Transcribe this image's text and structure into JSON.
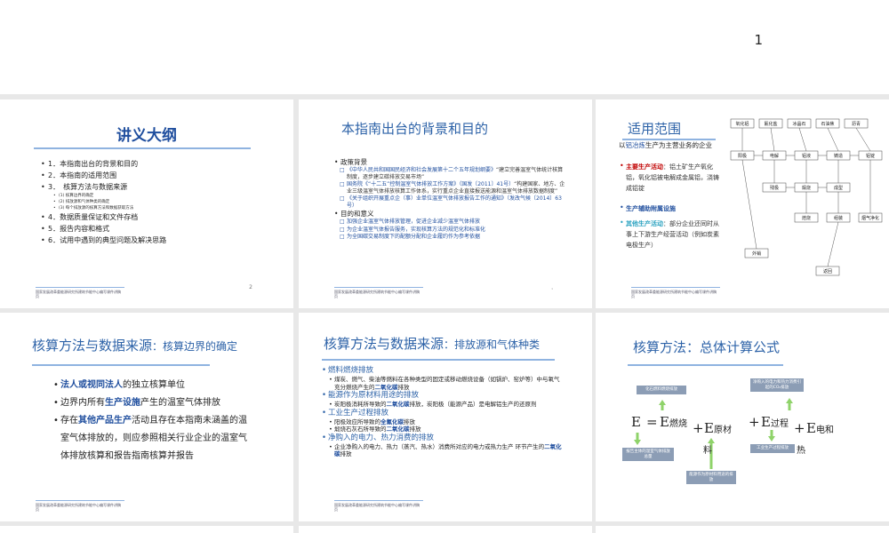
{
  "page_number": "1",
  "footer_text": "国家发展改革委能源研究所建筑节能中心编写课件讲稿",
  "footer_text_2": "页",
  "slide1": {
    "title": "讲义大纲",
    "items": [
      {
        "text": "1．本指南出台的背景和目的",
        "level": 1
      },
      {
        "text": "2．本指南的适用范围",
        "level": 1
      },
      {
        "text": "3．　核算方法与数据来源",
        "level": 1
      },
      {
        "text": "(1)  核算边界的确定",
        "level": 2
      },
      {
        "text": "(2)  排放源和气体种类的确定",
        "level": 2
      },
      {
        "text": "(3)  每个排放源的核算方法和数据获取方法",
        "level": 2
      },
      {
        "text": "4．数据质量保证和文件存档",
        "level": 1
      },
      {
        "text": "5．报告内容和格式",
        "level": 1
      },
      {
        "text": "6．试用中遇到的典型问题及解决思路",
        "level": 1
      }
    ],
    "slide_number": "2"
  },
  "slide2": {
    "title": "本指南出台的背景和目的",
    "heading1": "政策背景",
    "policy": [
      {
        "link": "《中华人民共和国国民经济和社会发展第十二个五年规划纲要》",
        "text": "“建立完善温室气体统计核算制度，逐步建立碳排放交易市场”"
      },
      {
        "link": "国务院《“十二五”控制温室气体排放工作方案》（国发〔2011〕41号）",
        "text": "“构建国家、地方、企业三级温室气体排放核算工作体系，实行重点企业直接报送能源和温室气体排放数据制度”"
      },
      {
        "link": "《关于组织开展重点企（事）业单位温室气体排放报告工作的通知》（发改气候〔2014〕63号）",
        "text": ""
      }
    ],
    "heading2": "目的和意义",
    "purpose": [
      "加强企业温室气体排放管理，促进企业减少温室气体排放",
      "为企业温室气体报告服务，实现核算方法的规范化和标准化",
      "为全国碳交易制度下的配额分配和企业履约作为参考依据"
    ],
    "slide_number": "1"
  },
  "slide3": {
    "title": "适用范围",
    "lead_pre": "以",
    "lead_highlight": "铝冶炼",
    "lead_post": "生产为主营业务的企业",
    "main_label": "主要生产活动",
    "main_text": "：铝土矿生产氧化铝，氧化铝被电解成金属铝，浇铸成铝锭",
    "aux_label": "生产辅助附属设施",
    "other_label": "其他生产活动",
    "other_text": "：部分企业还同时从事上下游生产经营活动（例如炭素电极生产）",
    "flow_nodes": [
      "氧化铝",
      "氟化盐",
      "冰晶石",
      "石油焦",
      "沥青",
      "阳极",
      "电解",
      "铝液",
      "铸造",
      "铝锭",
      "残极",
      "煅烧",
      "成型",
      "焙烧",
      "组装",
      "烟气净化",
      "外销",
      "返回"
    ]
  },
  "slide4": {
    "title": "核算方法与数据来源",
    "title_sub": "：核算边界的确定",
    "bullets": [
      {
        "em": "法人或视同法人",
        "pre": "",
        "post": "的独立核算单位"
      },
      {
        "em": "生产设施",
        "pre": "边界内所有",
        "post": "产生的温室气体排放"
      },
      {
        "em": "其他产品生产",
        "pre": "存在",
        "post": "活动且存在本指南未涵盖的温室气体排放的，则应参照相关行业企业的温室气体排放核算和报告指南核算并报告"
      }
    ]
  },
  "slide5": {
    "title": "核算方法与数据来源",
    "title_sub": "：排放源和气体种类",
    "groups": [
      {
        "head": "燃料燃烧排放",
        "lines": [
          {
            "pre": "煤炭、燃气、柴油等燃料在各种类型的固定或移动燃烧设备（如锅炉、窑炉等）中与氧气充分燃烧产生的",
            "em": "二氧化碳",
            "post": "排放"
          }
        ]
      },
      {
        "head": "能源作为原材料用途的排放",
        "lines": [
          {
            "pre": "炭阳极消耗所导致的",
            "em": "二氧化碳",
            "post": "排放，炭阳极（能源产品）是电解铝生产的还原剂"
          }
        ]
      },
      {
        "head": "工业生产过程排放",
        "lines": [
          {
            "pre": "阳极效应所导致的",
            "em": "全氟化碳",
            "post": "排放"
          },
          {
            "pre": "煅烧石灰石所导致的",
            "em": "二氧化碳",
            "post": "排放"
          }
        ]
      },
      {
        "head": "净购入的电力、热力消费的排放",
        "lines": [
          {
            "pre": "企业净购入的电力、热力（蒸汽、热水）消费所对应的电力或热力生产 环节产生的",
            "em": "二氧化碳",
            "post": "排放"
          }
        ]
      }
    ]
  },
  "slide6": {
    "title": "核算方法：总体计算公式",
    "eq_e": "E",
    "eq_eq": "=",
    "eq_plus": "+",
    "term1": "燃烧",
    "term2a": "原材",
    "term2b": "料",
    "term3": "过程",
    "term4a": "电和",
    "term4b": "热",
    "box1": "化石燃料燃烧排放",
    "box2": "报告主体的温室气体排放总量",
    "box3": "能源作为原材料用途的排放",
    "box4": "工业生产过程排放",
    "box5": "净购入的电力和热力消费引起的CO₂排放",
    "accent": "#8c9db5",
    "arrow": "#8fd36a"
  }
}
